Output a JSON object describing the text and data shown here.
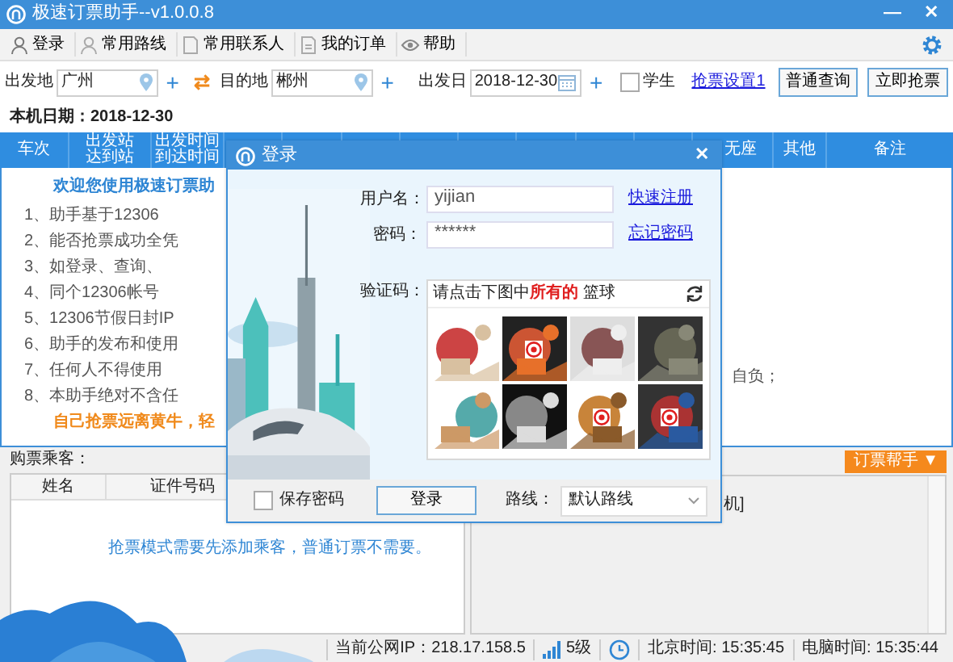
{
  "window": {
    "title": "极速订票助手--v1.0.0.8",
    "controls": [
      "—",
      "✕"
    ]
  },
  "toolbar": [
    {
      "label": "登录"
    },
    {
      "label": "常用路线"
    },
    {
      "label": "常用联系人"
    },
    {
      "label": "我的订单"
    },
    {
      "label": "帮助"
    }
  ],
  "query": {
    "from_label": "出发地",
    "from": "广州",
    "swap": "⇄",
    "to_label": "目的地",
    "to": "郴州",
    "date_label": "出发日",
    "date": "2018-12-30",
    "plus": "+",
    "student": {
      "label": "学生",
      "checked": false
    },
    "settings_link": "抢票设置1",
    "buttons": [
      "普通查询",
      "立即抢票"
    ]
  },
  "local_date": "本机日期：2018-12-30",
  "table": {
    "columns_left": [
      {
        "lines": [
          "车次"
        ]
      },
      {
        "lines": [
          "出发站",
          "达到站"
        ]
      },
      {
        "lines": [
          "出发时间",
          "到达时间"
        ]
      }
    ],
    "columns_right": [
      {
        "lines": [
          "无座"
        ]
      },
      {
        "lines": [
          "其他"
        ]
      },
      {
        "lines": [
          "备注"
        ]
      }
    ]
  },
  "notice": {
    "lines": [
      {
        "text": "欢迎您使用极速订票助",
        "kind": "title"
      },
      {
        "text": "1、助手基于12306",
        "kind": "item"
      },
      {
        "text": "2、能否抢票成功全凭",
        "kind": "item"
      },
      {
        "text": "3、如登录、查询、",
        "kind": "item"
      },
      {
        "text": "4、同个12306帐号",
        "kind": "item"
      },
      {
        "text": "5、12306节假日封IP",
        "kind": "item"
      },
      {
        "text": "6、助手的发布和使用",
        "kind": "item"
      },
      {
        "text": "7、任何人不得使用",
        "kind": "item"
      },
      {
        "text": "8、本助手绝对不含任",
        "kind": "item"
      },
      {
        "text": "自己抢票远离黄牛，轻",
        "kind": "slogan"
      }
    ],
    "right_fragment": "自负；"
  },
  "passengers": {
    "label": "购票乘客：",
    "columns": [
      "姓名",
      "证件号码"
    ],
    "hint": "抢票模式需要先添加乘客，普通订票不需要。"
  },
  "log": {
    "helper_button": "订票帮手 ▼",
    "fragment": "机]"
  },
  "status_bar": {
    "ip": "当前公网IP：218.17.158.5",
    "level": "5级",
    "beijing_time": "北京时间: 15:35:45",
    "pc_time": "电脑时间: 15:35:44"
  },
  "login_dialog": {
    "title": "登录",
    "close": "✕",
    "username_label": "用户名：",
    "username": "yijian",
    "register_link": "快速注册",
    "password_label": "密码：",
    "password": "******",
    "forgot_link": "忘记密码",
    "captcha_label": "验证码：",
    "captcha_prompt": "请点击下图中**所有的** 篮球",
    "captcha_images": [
      {
        "kind": "picture",
        "selected": false
      },
      {
        "kind": "picture",
        "selected": true
      },
      {
        "kind": "picture",
        "selected": false
      },
      {
        "kind": "picture",
        "selected": false
      },
      {
        "kind": "picture",
        "selected": false
      },
      {
        "kind": "picture",
        "selected": false
      },
      {
        "kind": "picture",
        "selected": true
      },
      {
        "kind": "picture",
        "selected": true
      }
    ],
    "save_password": {
      "label": "保存密码",
      "checked": false
    },
    "login_button": "登录",
    "route_label": "路线：",
    "route": "默认路线"
  }
}
